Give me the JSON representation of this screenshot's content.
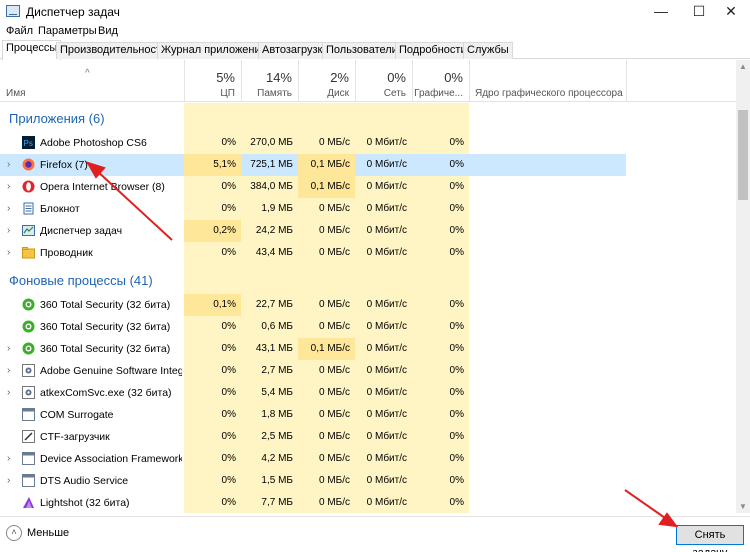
{
  "window": {
    "title": "Диспетчер задач",
    "min_glyph": "—",
    "max_glyph": "☐",
    "close_glyph": "✕"
  },
  "menu": [
    "Файл",
    "Параметры",
    "Вид"
  ],
  "tabs": [
    "Процессы",
    "Производительность",
    "Журнал приложений",
    "Автозагрузка",
    "Пользователи",
    "Подробности",
    "Службы"
  ],
  "columns": {
    "name": "Имя",
    "cpu": {
      "pct": "5%",
      "label": "ЦП"
    },
    "mem": {
      "pct": "14%",
      "label": "Память"
    },
    "disk": {
      "pct": "2%",
      "label": "Диск"
    },
    "net": {
      "pct": "0%",
      "label": "Сеть"
    },
    "gpu": {
      "pct": "0%",
      "label": "Графиче..."
    },
    "gpu_engine": "Ядро графического процессора"
  },
  "groups": {
    "apps": "Приложения (6)",
    "background": "Фоновые процессы (41)"
  },
  "apps": [
    {
      "name": "Adobe Photoshop CS6",
      "icon": "photoshop-icon",
      "cpu": "0%",
      "mem": "270,0 МБ",
      "disk": "0 МБ/с",
      "net": "0 Мбит/с",
      "gpu": "0%",
      "expand": ""
    },
    {
      "name": "Firefox (7)",
      "icon": "firefox-icon",
      "cpu": "5,1%",
      "mem": "725,1 МБ",
      "disk": "0,1 МБ/с",
      "net": "0 Мбит/с",
      "gpu": "0%",
      "expand": "›",
      "selected": true
    },
    {
      "name": "Opera Internet Browser (8)",
      "icon": "opera-icon",
      "cpu": "0%",
      "mem": "384,0 МБ",
      "disk": "0,1 МБ/с",
      "net": "0 Мбит/с",
      "gpu": "0%",
      "expand": "›"
    },
    {
      "name": "Блокнот",
      "icon": "notepad-icon",
      "cpu": "0%",
      "mem": "1,9 МБ",
      "disk": "0 МБ/с",
      "net": "0 Мбит/с",
      "gpu": "0%",
      "expand": "›"
    },
    {
      "name": "Диспетчер задач",
      "icon": "task-manager-icon",
      "cpu": "0,2%",
      "mem": "24,2 МБ",
      "disk": "0 МБ/с",
      "net": "0 Мбит/с",
      "gpu": "0%",
      "expand": "›"
    },
    {
      "name": "Проводник",
      "icon": "explorer-icon",
      "cpu": "0%",
      "mem": "43,4 МБ",
      "disk": "0 МБ/с",
      "net": "0 Мбит/с",
      "gpu": "0%",
      "expand": "›"
    }
  ],
  "background": [
    {
      "name": "360 Total Security (32 бита)",
      "icon": "360-security-icon",
      "cpu": "0,1%",
      "mem": "22,7 МБ",
      "disk": "0 МБ/с",
      "net": "0 Мбит/с",
      "gpu": "0%",
      "expand": ""
    },
    {
      "name": "360 Total Security (32 бита)",
      "icon": "360-security-icon",
      "cpu": "0%",
      "mem": "0,6 МБ",
      "disk": "0 МБ/с",
      "net": "0 Мбит/с",
      "gpu": "0%",
      "expand": ""
    },
    {
      "name": "360 Total Security (32 бита)",
      "icon": "360-security-icon",
      "cpu": "0%",
      "mem": "43,1 МБ",
      "disk": "0,1 МБ/с",
      "net": "0 Мбит/с",
      "gpu": "0%",
      "expand": "›"
    },
    {
      "name": "Adobe Genuine Software Integri...",
      "icon": "service-icon",
      "cpu": "0%",
      "mem": "2,7 МБ",
      "disk": "0 МБ/с",
      "net": "0 Мбит/с",
      "gpu": "0%",
      "expand": "›"
    },
    {
      "name": "atkexComSvc.exe (32 бита)",
      "icon": "service-icon",
      "cpu": "0%",
      "mem": "5,4 МБ",
      "disk": "0 МБ/с",
      "net": "0 Мбит/с",
      "gpu": "0%",
      "expand": "›"
    },
    {
      "name": "COM Surrogate",
      "icon": "app-window-icon",
      "cpu": "0%",
      "mem": "1,8 МБ",
      "disk": "0 МБ/с",
      "net": "0 Мбит/с",
      "gpu": "0%",
      "expand": ""
    },
    {
      "name": "CTF-загрузчик",
      "icon": "pen-icon",
      "cpu": "0%",
      "mem": "2,5 МБ",
      "disk": "0 МБ/с",
      "net": "0 Мбит/с",
      "gpu": "0%",
      "expand": ""
    },
    {
      "name": "Device Association Framework ...",
      "icon": "app-window-icon",
      "cpu": "0%",
      "mem": "4,2 МБ",
      "disk": "0 МБ/с",
      "net": "0 Мбит/с",
      "gpu": "0%",
      "expand": "›"
    },
    {
      "name": "DTS Audio Service",
      "icon": "app-window-icon",
      "cpu": "0%",
      "mem": "1,5 МБ",
      "disk": "0 МБ/с",
      "net": "0 Мбит/с",
      "gpu": "0%",
      "expand": "›"
    },
    {
      "name": "Lightshot (32 бита)",
      "icon": "lightshot-icon",
      "cpu": "0%",
      "mem": "7,7 МБ",
      "disk": "0 МБ/с",
      "net": "0 Мбит/с",
      "gpu": "0%",
      "expand": ""
    }
  ],
  "footer": {
    "less_icon_glyph": "˄",
    "less": "Меньше",
    "end_task": "Снять задачу"
  },
  "sort_glyph": "^",
  "colors": {
    "accent": "#0078d7",
    "group_title": "#1e64b4",
    "selection": "#cce8ff",
    "heat_light": "#fff4c4",
    "heat_strong": "#ffe79a",
    "annotation_arrow": "#e02020"
  }
}
